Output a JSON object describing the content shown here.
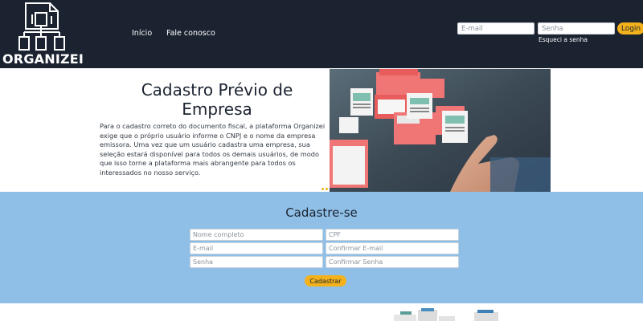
{
  "header": {
    "logo_text": "ORGANIZEI",
    "nav": [
      {
        "label": "Início"
      },
      {
        "label": "Fale conosco"
      }
    ],
    "email_placeholder": "E-mail",
    "senha_placeholder": "Senha",
    "login_label": "Login",
    "forgot_label": "Esqueci a senha"
  },
  "hero": {
    "title": "Cadastro Prévio de Empresa",
    "text": "Para o cadastro correto do documento fiscal, a plataforma Organizei exige que o próprio usuário informe o CNPJ e o nome da empresa emissora. Uma vez que um usuário cadastra uma empresa, sua seleção estará disponível para todos os demais usuários, de modo que isso torne a plataforma mais abrangente para todos os interessados no nosso serviço."
  },
  "register": {
    "title": "Cadastre-se",
    "fields": {
      "nome": "Nome completo",
      "cpf": "CPF",
      "email": "E-mail",
      "confirmar_email": "Confirmar E-mail",
      "senha": "Senha",
      "confirmar_senha": "Confirmar Senha"
    },
    "submit_label": "Cadastrar"
  },
  "colors": {
    "header_bg": "#1b2331",
    "accent": "#f3b21c",
    "register_bg": "#8fbfe6"
  },
  "icons": {
    "logo": "document-hierarchy-icon"
  }
}
